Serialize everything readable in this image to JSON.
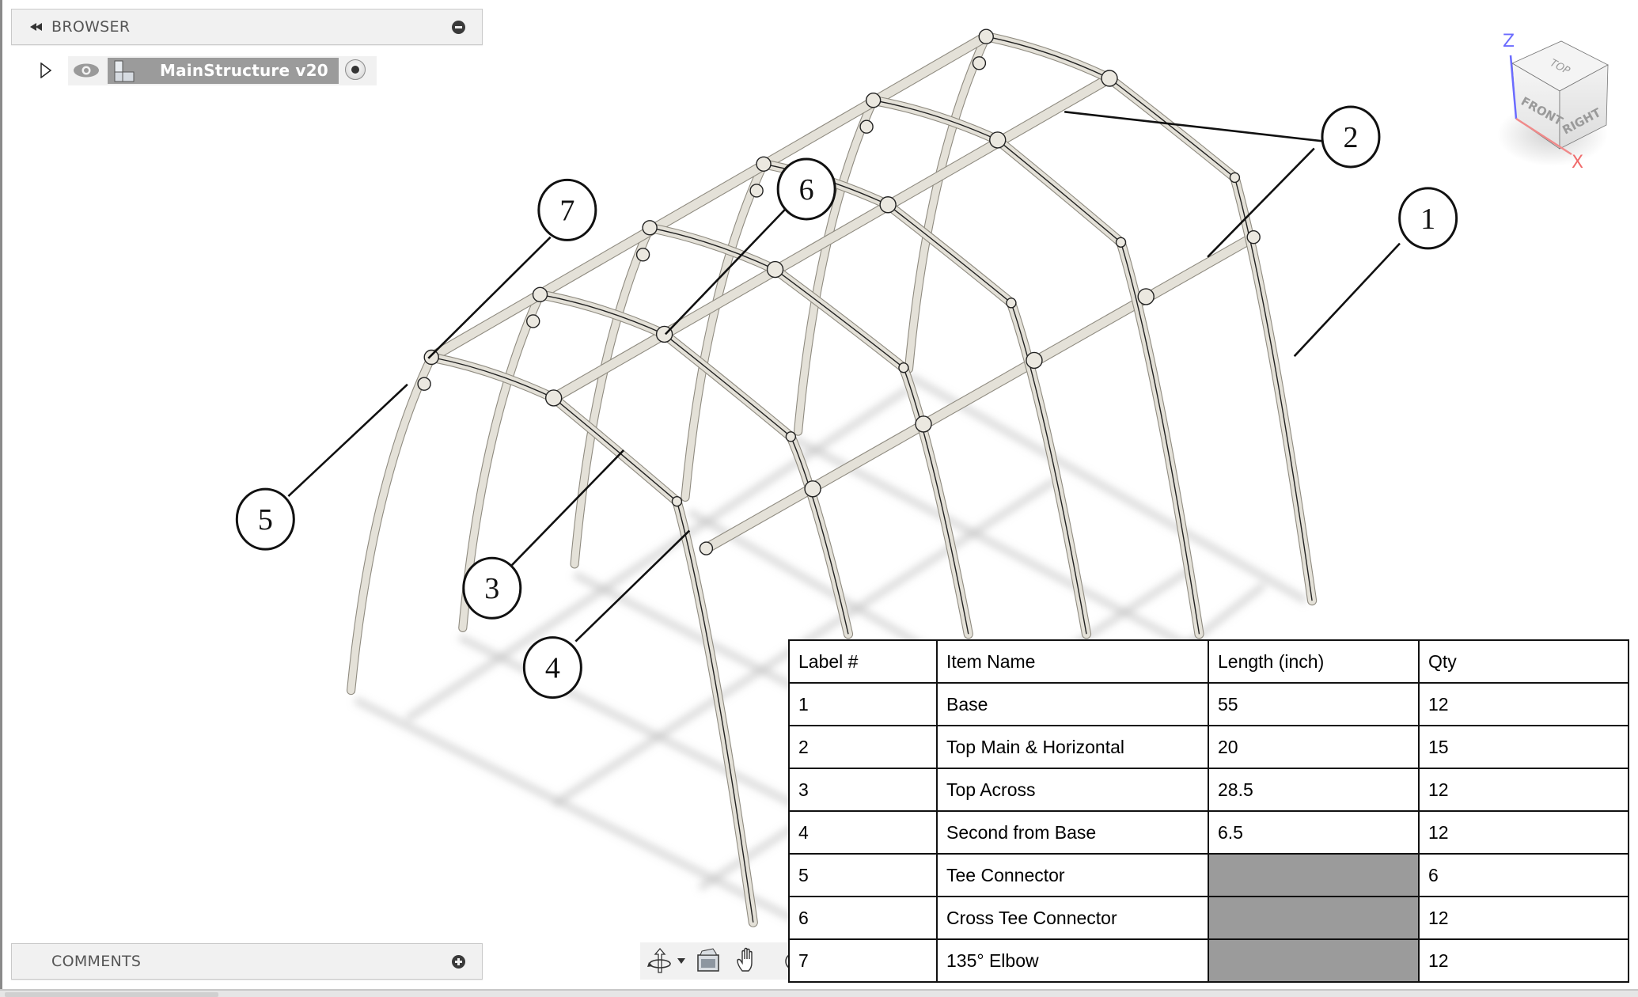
{
  "browser": {
    "title": "BROWSER",
    "collapse_icon": "double-left-arrow-icon",
    "toggle_icon": "minus-circle-icon",
    "tree": [
      {
        "name": "MainStructure v20",
        "expand_icon": "triangle-right-icon",
        "visibility_icon": "eye-icon",
        "type_icon": "component-icon",
        "activate_icon": "radio-dot-icon"
      }
    ]
  },
  "comments": {
    "title": "COMMENTS",
    "toggle_icon": "plus-circle-icon"
  },
  "toolbar": {
    "items": [
      {
        "icon": "orbit-icon",
        "label": "Orbit"
      },
      {
        "icon": "dropdown-caret-icon",
        "label": "Orbit options"
      },
      {
        "icon": "look-at-icon",
        "label": "Look At"
      },
      {
        "icon": "pan-hand-icon",
        "label": "Pan"
      },
      {
        "icon": "zoom-icon",
        "label": "Zoom"
      }
    ]
  },
  "viewcube": {
    "faces": [
      "TOP",
      "FRONT",
      "RIGHT"
    ],
    "axes": {
      "z": "Z",
      "x": "X"
    },
    "colors": {
      "z": "#6b6bff",
      "x": "#f06a6a"
    }
  },
  "callouts": [
    {
      "label": "1",
      "target": "Base"
    },
    {
      "label": "2",
      "target": "Top Main & Horizontal"
    },
    {
      "label": "3",
      "target": "Top Across"
    },
    {
      "label": "4",
      "target": "Second from Base"
    },
    {
      "label": "5",
      "target": "Tee Connector"
    },
    {
      "label": "6",
      "target": "Cross Tee Connector"
    },
    {
      "label": "7",
      "target": "135° Elbow"
    }
  ],
  "bom_table": {
    "headers": [
      "Label #",
      "Item Name",
      "Length (inch)",
      "Qty"
    ],
    "rows": [
      {
        "label": "1",
        "name": "Base",
        "length": "55",
        "qty": "12"
      },
      {
        "label": "2",
        "name": "Top Main & Horizontal",
        "length": "20",
        "qty": "15"
      },
      {
        "label": "3",
        "name": "Top Across",
        "length": "28.5",
        "qty": "12"
      },
      {
        "label": "4",
        "name": "Second from Base",
        "length": "6.5",
        "qty": "12"
      },
      {
        "label": "5",
        "name": "Tee Connector",
        "length": "",
        "qty": "6"
      },
      {
        "label": "6",
        "name": "Cross Tee Connector",
        "length": "",
        "qty": "12"
      },
      {
        "label": "7",
        "name": "135° Elbow",
        "length": "",
        "qty": "12"
      }
    ],
    "blank_cell_color": "#9b9b9b"
  },
  "colors": {
    "pipe": "#e4e1d8",
    "pipe_edge": "#222222",
    "panel_bg": "#f1f1f1",
    "selected_component_bg": "#9b9b9b"
  }
}
